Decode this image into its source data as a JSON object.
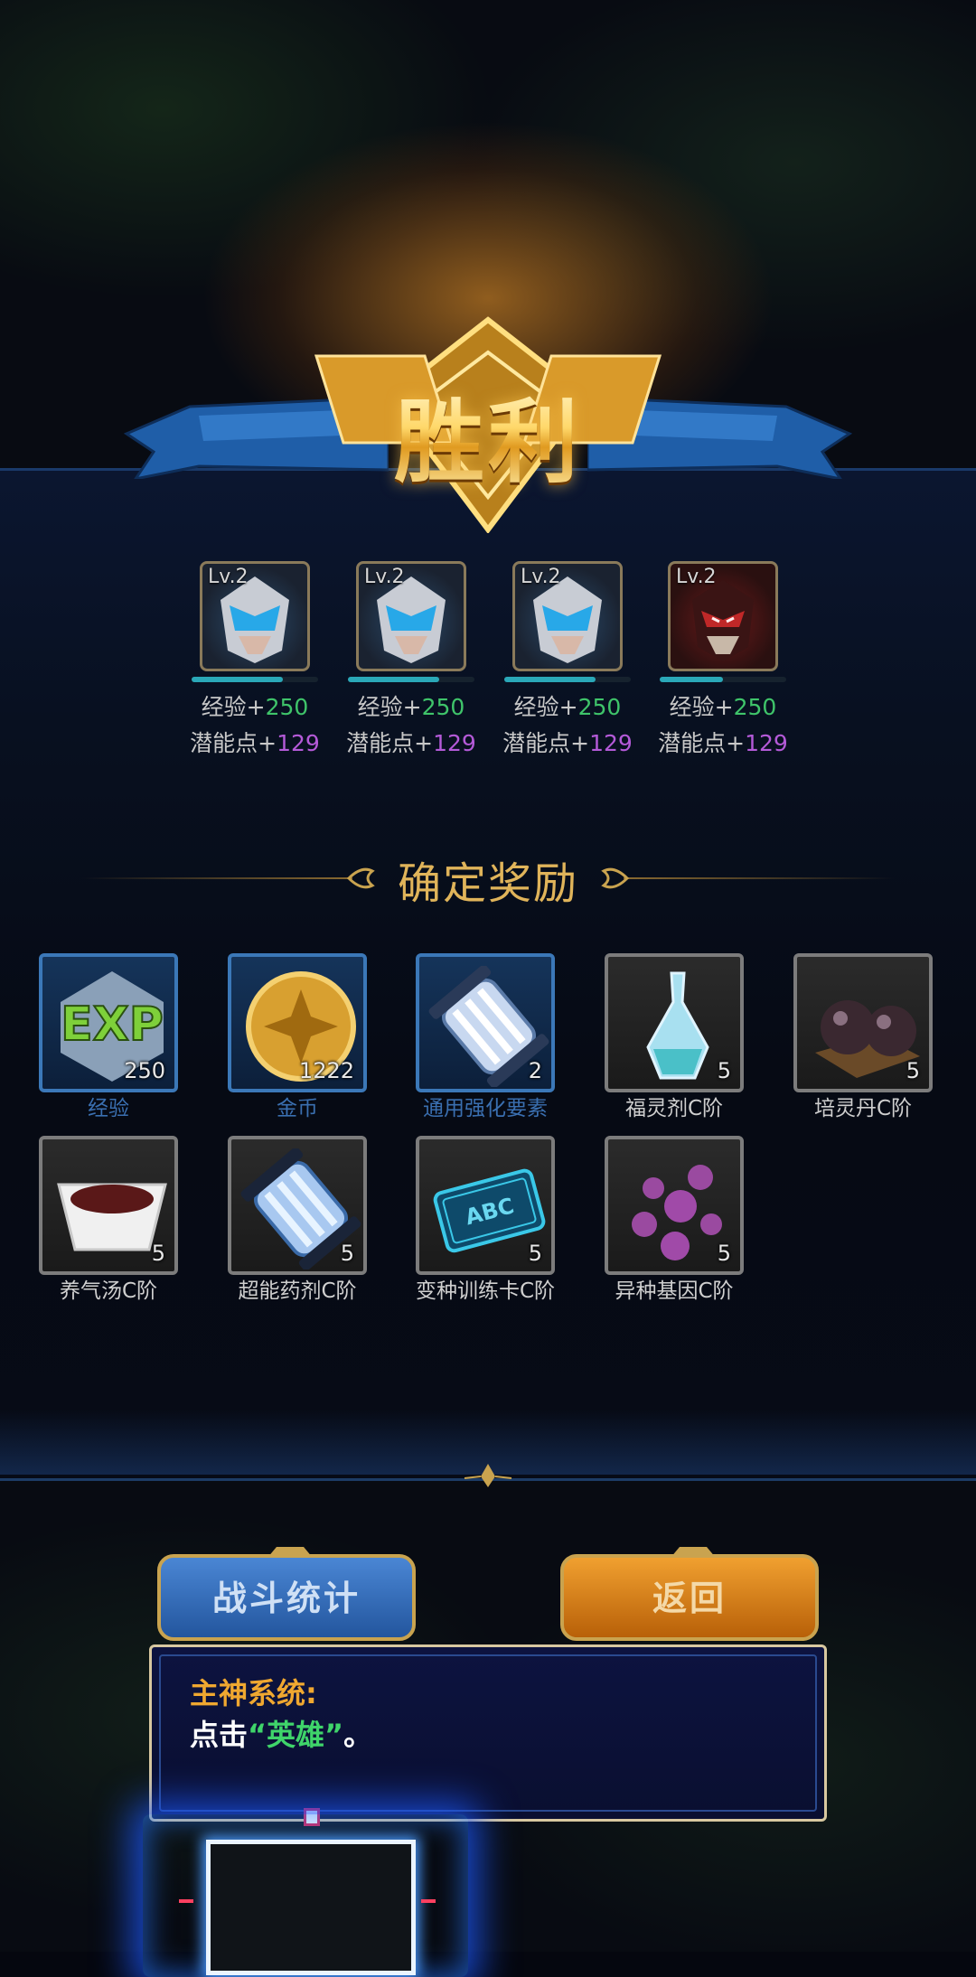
{
  "victory": {
    "title": "胜利"
  },
  "heroes": [
    {
      "level": "Lv.2",
      "exp_label": "经验+",
      "exp_value": "250",
      "pot_label": "潜能点+",
      "pot_value": "129",
      "style": "blue",
      "exp_progress": 0.72
    },
    {
      "level": "Lv.2",
      "exp_label": "经验+",
      "exp_value": "250",
      "pot_label": "潜能点+",
      "pot_value": "129",
      "style": "blue",
      "exp_progress": 0.72
    },
    {
      "level": "Lv.2",
      "exp_label": "经验+",
      "exp_value": "250",
      "pot_label": "潜能点+",
      "pot_value": "129",
      "style": "blue",
      "exp_progress": 0.72
    },
    {
      "level": "Lv.2",
      "exp_label": "经验+",
      "exp_value": "250",
      "pot_label": "潜能点+",
      "pot_value": "129",
      "style": "red",
      "exp_progress": 0.5
    }
  ],
  "rewards": {
    "title": "确定奖励",
    "items": [
      {
        "label": "经验",
        "count": "250",
        "icon": "exp-icon"
      },
      {
        "label": "金币",
        "count": "1222",
        "icon": "gold-coin-icon"
      },
      {
        "label": "通用强化要素",
        "count": "2",
        "icon": "enhance-capsule-icon"
      },
      {
        "label": "福灵剂C阶",
        "count": "5",
        "icon": "potion-bottle-icon"
      },
      {
        "label": "培灵丹C阶",
        "count": "5",
        "icon": "pill-icon"
      },
      {
        "label": "养气汤C阶",
        "count": "5",
        "icon": "soup-bowl-icon"
      },
      {
        "label": "超能药剂C阶",
        "count": "5",
        "icon": "serum-capsule-icon"
      },
      {
        "label": "变种训练卡C阶",
        "count": "5",
        "icon": "training-card-icon"
      },
      {
        "label": "异种基因C阶",
        "count": "5",
        "icon": "gene-orbs-icon"
      }
    ],
    "card_text": "ABC"
  },
  "buttons": {
    "stats": "战斗统计",
    "back": "返回"
  },
  "dialog": {
    "speaker": "主神系统:",
    "text_prefix": "点击",
    "text_highlight": "“英雄”",
    "text_suffix": "。"
  },
  "colors": {
    "exp_value": "#3fc46a",
    "pot_value": "#b45ad8",
    "title_gold": "#e0b45a",
    "highlight_green": "#3fd46a"
  }
}
